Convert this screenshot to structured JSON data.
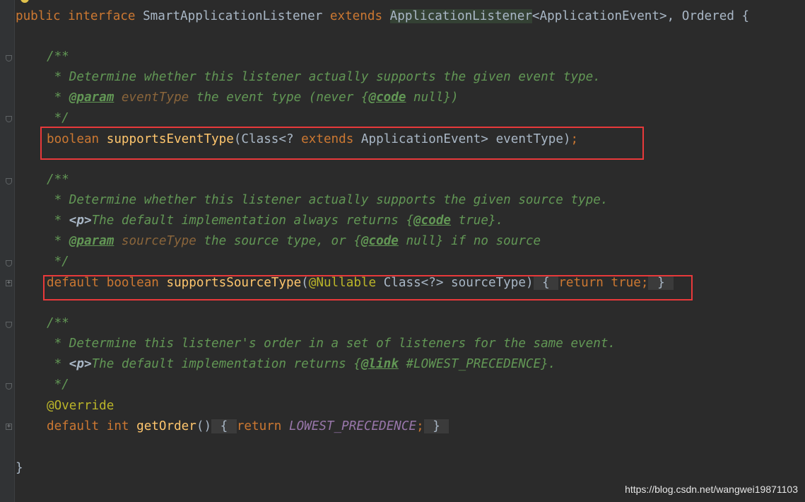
{
  "editor": {
    "lines": {
      "decl": {
        "kw1": "public",
        "kw2": "interface",
        "name": "SmartApplicationListener",
        "kw3": "extends",
        "superType": "ApplicationListener",
        "generic": "<ApplicationEvent>,",
        "tail": " Ordered {"
      },
      "doc1": {
        "open": "/**",
        "desc": " * Determine whether this listener actually supports the given event type.",
        "param_prefix": " * ",
        "param_tag": "@param",
        "param_name": " eventType",
        "param_text": " the event type (never {",
        "code_tag": "@code",
        "param_tail": " null})",
        "close": " */"
      },
      "m1": {
        "kw": "boolean",
        "name": "supportsEventType",
        "args_a": "(Class<? ",
        "kw_ext": "extends",
        "args_b": " ApplicationEvent> eventType)",
        "semi": ";"
      },
      "doc2": {
        "open": "/**",
        "desc": " * Determine whether this listener actually supports the given source type.",
        "p_prefix": " * ",
        "p_tag": "<p>",
        "p_text": "The default implementation always returns {",
        "code_tag": "@code",
        "p_tail": " true}.",
        "param_prefix": " * ",
        "param_tag": "@param",
        "param_name": " sourceType",
        "param_text": " the source type, or {",
        "code_tag2": "@code",
        "param_tail": " null} if no source",
        "close": " */"
      },
      "m2": {
        "kw1": "default",
        "kw2": "boolean",
        "name": "supportsSourceType",
        "paren": "(",
        "ann": "@Nullable",
        "args": " Class<?> sourceType)",
        "brace_open": "{",
        "ret": "return",
        "val": "true",
        "semi": ";",
        "brace_close": "}"
      },
      "doc3": {
        "open": "/**",
        "desc": " * Determine this listener's order in a set of listeners for the same event.",
        "p_prefix": " * ",
        "p_tag": "<p>",
        "p_text": "The default implementation returns {",
        "link_tag": "@link",
        "p_tail": " #LOWEST_PRECEDENCE}.",
        "close": " */"
      },
      "override": "@Override",
      "m3": {
        "kw1": "default",
        "kw2": "int",
        "name": "getOrder",
        "parens": "()",
        "brace_open": "{",
        "ret": "return",
        "const": "LOWEST_PRECEDENCE",
        "semi": ";",
        "brace_close": "}"
      },
      "end": "}"
    }
  },
  "watermark": "https://blog.csdn.net/wangwei19871103",
  "colors": {
    "background": "#2b2b2b",
    "keyword": "#cc7832",
    "method": "#ffc66d",
    "comment": "#629755",
    "annotation": "#bbb529",
    "constant": "#9876aa",
    "highlight_box": "#e8393a"
  }
}
